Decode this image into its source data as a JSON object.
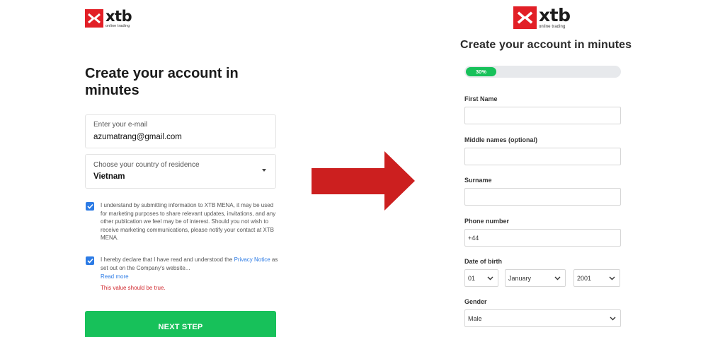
{
  "brand": {
    "name": "xtb",
    "tagline": "online trading",
    "accent": "#e21f26"
  },
  "left": {
    "title": "Create your account in minutes",
    "email": {
      "label": "Enter your e-mail",
      "value": "azumatrang@gmail.com"
    },
    "country": {
      "label": "Choose your country of residence",
      "value": "Vietnam"
    },
    "consent_marketing": "I understand by submitting information to XTB MENA, it may be used for marketing purposes to share relevant updates, invitations, and any other publication we feel may be of interest. Should you not wish to receive marketing communications, please notify your contact at XTB MENA.",
    "consent_privacy_prefix": "I hereby declare that I have read and understood the ",
    "consent_privacy_link": "Privacy Notice",
    "consent_privacy_suffix": " as set out on the Company's website...",
    "read_more": "Read more",
    "error": "This value should be true.",
    "next_button": "NEXT STEP",
    "checkbox_color": "#2c7be5",
    "button_color": "#17c15a"
  },
  "right": {
    "title": "Create your account in minutes",
    "progress": {
      "percent": 30,
      "label": "30%"
    },
    "first_name_label": "First Name",
    "middle_names_label": "Middle names (optional)",
    "surname_label": "Surname",
    "phone": {
      "label": "Phone number",
      "value": "+44"
    },
    "dob": {
      "label": "Date of birth",
      "day": "01",
      "month": "January",
      "year": "2001"
    },
    "gender": {
      "label": "Gender",
      "value": "Male"
    }
  },
  "arrow": {
    "color": "#cc1f1f",
    "icon": "arrow-right-icon"
  }
}
